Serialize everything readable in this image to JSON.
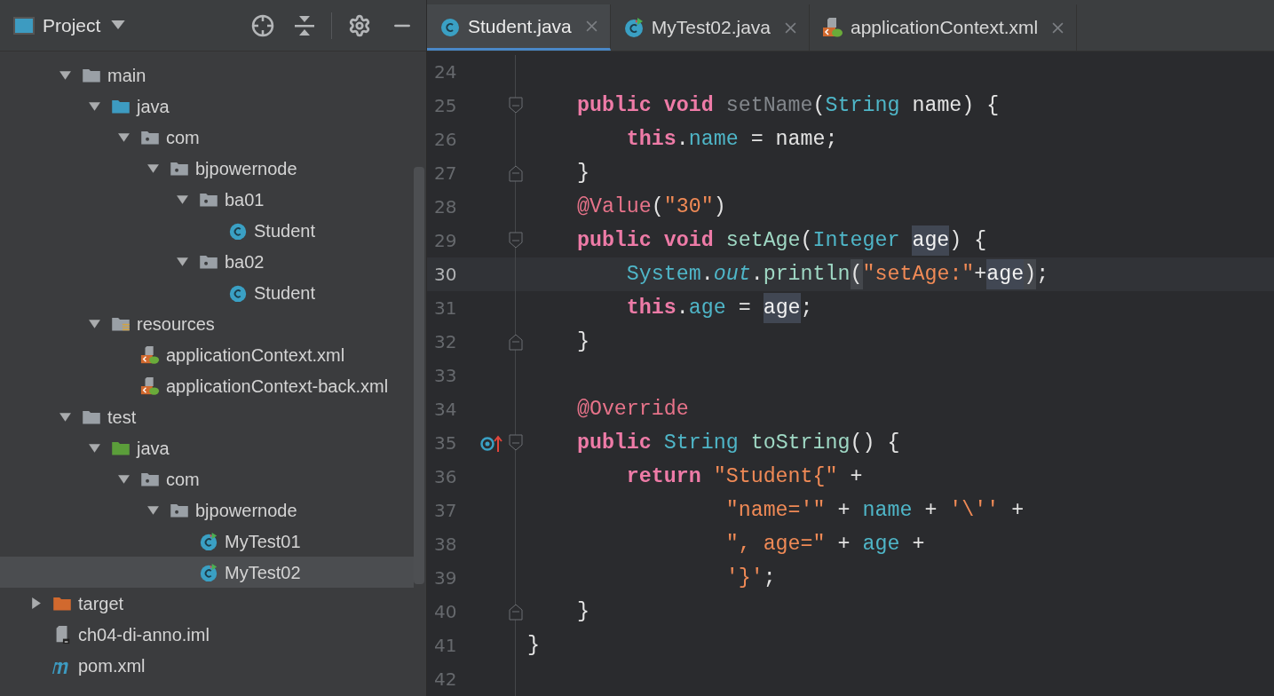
{
  "project_panel": {
    "title": "Project",
    "nested_items": [
      {
        "label": "main",
        "kind": "folder",
        "expanded": true,
        "selected": false,
        "children": [
          {
            "label": "java",
            "kind": "source-folder",
            "expanded": true,
            "selected": false,
            "children": [
              {
                "label": "com",
                "kind": "package",
                "expanded": true,
                "selected": false,
                "children": [
                  {
                    "label": "bjpowernode",
                    "kind": "package",
                    "expanded": true,
                    "selected": false,
                    "children": [
                      {
                        "label": "ba01",
                        "kind": "package",
                        "expanded": true,
                        "selected": false,
                        "children": [
                          {
                            "label": "Student",
                            "kind": "class",
                            "selected": false
                          }
                        ]
                      },
                      {
                        "label": "ba02",
                        "kind": "package",
                        "expanded": true,
                        "selected": false,
                        "children": [
                          {
                            "label": "Student",
                            "kind": "class",
                            "selected": false
                          }
                        ]
                      }
                    ]
                  }
                ]
              }
            ]
          },
          {
            "label": "resources",
            "kind": "resources-folder",
            "expanded": true,
            "selected": false,
            "children": [
              {
                "label": "applicationContext.xml",
                "kind": "spring-xml",
                "selected": false
              },
              {
                "label": "applicationContext-back.xml",
                "kind": "spring-xml",
                "selected": false
              }
            ]
          }
        ]
      },
      {
        "label": "test",
        "kind": "folder",
        "expanded": true,
        "selected": false,
        "children": [
          {
            "label": "java",
            "kind": "test-folder",
            "expanded": true,
            "selected": false,
            "children": [
              {
                "label": "com",
                "kind": "package",
                "expanded": true,
                "selected": false,
                "children": [
                  {
                    "label": "bjpowernode",
                    "kind": "package",
                    "expanded": true,
                    "selected": false,
                    "children": [
                      {
                        "label": "MyTest01",
                        "kind": "test-class",
                        "selected": false
                      },
                      {
                        "label": "MyTest02",
                        "kind": "test-class",
                        "selected": true
                      }
                    ]
                  }
                ]
              }
            ]
          }
        ]
      }
    ],
    "root_items": [
      {
        "label": "target",
        "kind": "excluded-folder",
        "expanded": false,
        "selected": false
      },
      {
        "label": "ch04-di-anno.iml",
        "kind": "iml-file",
        "selected": false
      },
      {
        "label": "pom.xml",
        "kind": "maven-file",
        "selected": false
      }
    ]
  },
  "tabs": [
    {
      "label": "Student.java",
      "kind": "class",
      "selected": true
    },
    {
      "label": "MyTest02.java",
      "kind": "test-class",
      "selected": false
    },
    {
      "label": "applicationContext.xml",
      "kind": "spring-xml",
      "selected": false
    }
  ],
  "editor": {
    "lines": [
      {
        "number": "24",
        "kind": "plain",
        "current": false
      },
      {
        "number": "25",
        "kind": "fold-start",
        "current": false,
        "tokens": [
          {
            "text": "    public void ",
            "kind": "keyword"
          },
          {
            "text": "setName",
            "kind": "unused"
          },
          {
            "text": "(",
            "kind": "plain"
          },
          {
            "text": "String",
            "kind": "type"
          },
          {
            "text": " name) {",
            "kind": "plain"
          }
        ]
      },
      {
        "number": "26",
        "kind": "plain",
        "current": false,
        "tokens": [
          {
            "text": "        this",
            "kind": "keyword"
          },
          {
            "text": ".",
            "kind": "plain"
          },
          {
            "text": "name",
            "kind": "field"
          },
          {
            "text": " = name;",
            "kind": "plain"
          }
        ]
      },
      {
        "number": "27",
        "kind": "fold-end",
        "current": false,
        "tokens": [
          {
            "text": "    }",
            "kind": "plain"
          }
        ]
      },
      {
        "number": "28",
        "kind": "plain",
        "current": false,
        "tokens": [
          {
            "text": "    @Value",
            "kind": "annotation"
          },
          {
            "text": "(",
            "kind": "plain"
          },
          {
            "text": "\"30\"",
            "kind": "string"
          },
          {
            "text": ")",
            "kind": "plain"
          }
        ]
      },
      {
        "number": "29",
        "kind": "fold-start",
        "current": false,
        "tokens": [
          {
            "text": "    public void ",
            "kind": "keyword"
          },
          {
            "text": "setAge",
            "kind": "method"
          },
          {
            "text": "(",
            "kind": "plain"
          },
          {
            "text": "Integer ",
            "kind": "type"
          },
          {
            "text": "age",
            "kind": "occurrence"
          },
          {
            "text": ") {",
            "kind": "plain"
          }
        ]
      },
      {
        "number": "30",
        "kind": "plain",
        "current": true,
        "tokens": [
          {
            "text": "        System",
            "kind": "type"
          },
          {
            "text": ".",
            "kind": "plain"
          },
          {
            "text": "out",
            "kind": "static-field"
          },
          {
            "text": ".",
            "kind": "plain"
          },
          {
            "text": "println",
            "kind": "method"
          },
          {
            "text": "(",
            "kind": "brace-match"
          },
          {
            "text": "\"setAge:\"",
            "kind": "string"
          },
          {
            "text": "+",
            "kind": "plain"
          },
          {
            "text": "age",
            "kind": "occurrence"
          },
          {
            "text": ")",
            "kind": "brace-match"
          },
          {
            "text": ";",
            "kind": "plain"
          }
        ]
      },
      {
        "number": "31",
        "kind": "plain",
        "current": false,
        "tokens": [
          {
            "text": "        this",
            "kind": "keyword"
          },
          {
            "text": ".",
            "kind": "plain"
          },
          {
            "text": "age",
            "kind": "field"
          },
          {
            "text": " = ",
            "kind": "plain"
          },
          {
            "text": "age",
            "kind": "occurrence"
          },
          {
            "text": ";",
            "kind": "plain"
          }
        ]
      },
      {
        "number": "32",
        "kind": "fold-end",
        "current": false,
        "tokens": [
          {
            "text": "    }",
            "kind": "plain"
          }
        ]
      },
      {
        "number": "33",
        "kind": "plain",
        "current": false
      },
      {
        "number": "34",
        "kind": "plain",
        "current": false,
        "tokens": [
          {
            "text": "    @Override",
            "kind": "annotation"
          }
        ]
      },
      {
        "number": "35",
        "kind": "override-fold-start",
        "current": false,
        "tokens": [
          {
            "text": "    public ",
            "kind": "keyword"
          },
          {
            "text": "String ",
            "kind": "type"
          },
          {
            "text": "toString",
            "kind": "method"
          },
          {
            "text": "() {",
            "kind": "plain"
          }
        ]
      },
      {
        "number": "36",
        "kind": "plain",
        "current": false,
        "tokens": [
          {
            "text": "        return ",
            "kind": "keyword"
          },
          {
            "text": "\"Student{\"",
            "kind": "string"
          },
          {
            "text": " +",
            "kind": "plain"
          }
        ]
      },
      {
        "number": "37",
        "kind": "plain",
        "current": false,
        "tokens": [
          {
            "text": "                \"name='\"",
            "kind": "string"
          },
          {
            "text": " + ",
            "kind": "plain"
          },
          {
            "text": "name",
            "kind": "field"
          },
          {
            "text": " + ",
            "kind": "plain"
          },
          {
            "text": "'\\''",
            "kind": "string"
          },
          {
            "text": " +",
            "kind": "plain"
          }
        ]
      },
      {
        "number": "38",
        "kind": "plain",
        "current": false,
        "tokens": [
          {
            "text": "                \", age=\"",
            "kind": "string"
          },
          {
            "text": " + ",
            "kind": "plain"
          },
          {
            "text": "age",
            "kind": "field"
          },
          {
            "text": " +",
            "kind": "plain"
          }
        ]
      },
      {
        "number": "39",
        "kind": "plain",
        "current": false,
        "tokens": [
          {
            "text": "                '}'",
            "kind": "string"
          },
          {
            "text": ";",
            "kind": "plain"
          }
        ]
      },
      {
        "number": "40",
        "kind": "fold-end",
        "current": false,
        "tokens": [
          {
            "text": "    }",
            "kind": "plain"
          }
        ]
      },
      {
        "number": "41",
        "kind": "plain",
        "current": false,
        "tokens": [
          {
            "text": "}",
            "kind": "plain"
          }
        ]
      },
      {
        "number": "42",
        "kind": "plain",
        "current": false
      }
    ]
  }
}
